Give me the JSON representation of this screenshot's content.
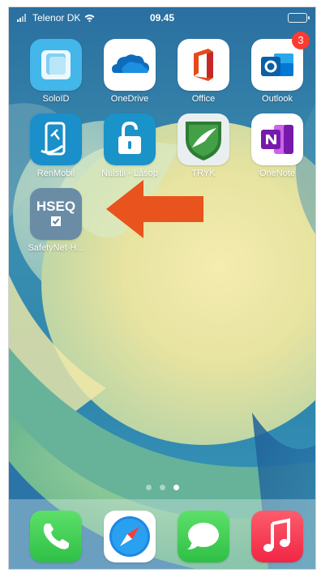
{
  "status_bar": {
    "carrier": "Telenor DK",
    "time": "09.45"
  },
  "apps": [
    {
      "label": "SoloID",
      "icon": "soloid-app-icon"
    },
    {
      "label": "OneDrive",
      "icon": "onedrive-app-icon"
    },
    {
      "label": "Office",
      "icon": "office-app-icon"
    },
    {
      "label": "Outlook",
      "icon": "outlook-app-icon",
      "badge": "3"
    },
    {
      "label": "RenMobil",
      "icon": "renmobil-app-icon"
    },
    {
      "label": "Nulstil - Låsop",
      "icon": "nulstil-lasop-app-icon"
    },
    {
      "label": "TRYK",
      "icon": "tryk-app-icon"
    },
    {
      "label": "OneNote",
      "icon": "onenote-app-icon"
    },
    {
      "label": "SafetyNet-H...",
      "icon": "hseq-app-icon",
      "icon_text": "HSEQ"
    }
  ],
  "page_dots": {
    "count": 3,
    "active_index": 2
  },
  "dock": [
    {
      "name": "Phone",
      "icon": "phone-icon"
    },
    {
      "name": "Safari",
      "icon": "safari-icon"
    },
    {
      "name": "Messages",
      "icon": "messages-icon"
    },
    {
      "name": "Music",
      "icon": "music-icon"
    }
  ],
  "annotation": {
    "type": "arrow",
    "direction": "left",
    "color": "#e8531e"
  }
}
